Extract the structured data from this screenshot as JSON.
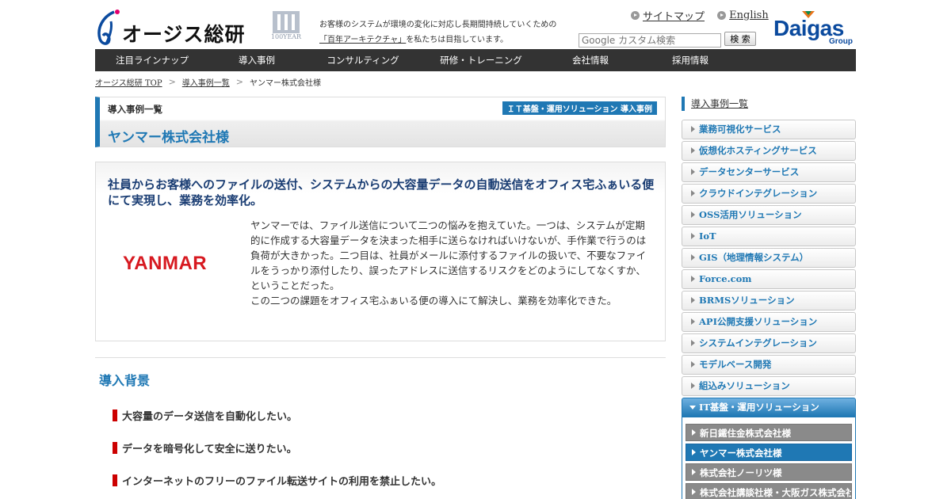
{
  "header": {
    "logo_text": "オージス総研",
    "year_label": "100YEAR",
    "tagline_line1": "お客様のシステムが環境の変化に対応し長期間持続していくための",
    "tagline_link": "「百年アーキテクチャ」",
    "tagline_line2_rest": "を私たちは目指しています。",
    "links": [
      {
        "label": "サイトマップ"
      },
      {
        "label": "English"
      }
    ],
    "search_placeholder": "Google カスタム検索",
    "search_button": "検 索",
    "group_logo": "Daigas",
    "group_sub": "Group"
  },
  "nav": [
    {
      "label": "注目ラインナップ"
    },
    {
      "label": "導入事例"
    },
    {
      "label": "コンサルティング"
    },
    {
      "label": "研修・トレーニング"
    },
    {
      "label": "会社情報"
    },
    {
      "label": "採用情報"
    }
  ],
  "breadcrumb": [
    {
      "label": "オージス総研 TOP"
    },
    {
      "label": "導入事例一覧"
    },
    {
      "label": "ヤンマー株式会社様"
    }
  ],
  "page_head": {
    "category": "導入事例一覧",
    "badge": "ＩＴ基盤・運用ソリューション 導入事例",
    "title": "ヤンマー株式会社様"
  },
  "summary": {
    "title": "社員からお客様へのファイルの送付、システムからの大容量データの自動送信をオフィス宅ふぁいる便にて実現し、業務を効率化。",
    "company_logo": "YANMAR",
    "paragraph1": "ヤンマーでは、ファイル送信について二つの悩みを抱えていた。一つは、システムが定期的に作成する大容量データを決まった相手に送らなければいけないが、手作業で行うのは負荷が大きかった。二つ目は、社員がメールに添付するファイルの扱いで、不要なファイルをうっかり添付したり、誤ったアドレスに送信するリスクをどのようにしてなくすか、ということだった。",
    "paragraph2": "この二つの課題をオフィス宅ふぁいる便の導入にて解決し、業務を効率化できた。"
  },
  "background": {
    "title": "導入背景",
    "items": [
      {
        "label": "大容量のデータ送信を自動化したい。"
      },
      {
        "label": "データを暗号化して安全に送りたい。"
      },
      {
        "label": "インターネットのフリーのファイル転送サイトの利用を禁止したい。"
      }
    ]
  },
  "sidebar": {
    "heading": "導入事例一覧",
    "items": [
      {
        "label": "業務可視化サービス"
      },
      {
        "label": "仮想化ホスティングサービス"
      },
      {
        "label": "データセンターサービス"
      },
      {
        "label": "クラウドインテグレーション"
      },
      {
        "label": "OSS活用ソリューション"
      },
      {
        "label": "IoT"
      },
      {
        "label": "GIS（地理情報システム）"
      },
      {
        "label": "Force.com"
      },
      {
        "label": "BRMSソリューション"
      },
      {
        "label": "API公開支援ソリューション"
      },
      {
        "label": "システムインテグレーション"
      },
      {
        "label": "モデルベース開発"
      },
      {
        "label": "組込みソリューション"
      }
    ],
    "active_item": "IT基盤・運用ソリューション",
    "sub_items": [
      {
        "label": "新日鐵住金株式会社様"
      },
      {
        "label": "ヤンマー株式会社様"
      },
      {
        "label": "株式会社ノーリツ様"
      },
      {
        "label": "株式会社講談社様・大阪ガス株式会社様"
      }
    ]
  },
  "colors": {
    "accent": "#1f78b4",
    "nav_bg": "#333333",
    "bullet": "#cc0000",
    "yanmar_red": "#d71920",
    "summary_title": "#1a3d73"
  }
}
